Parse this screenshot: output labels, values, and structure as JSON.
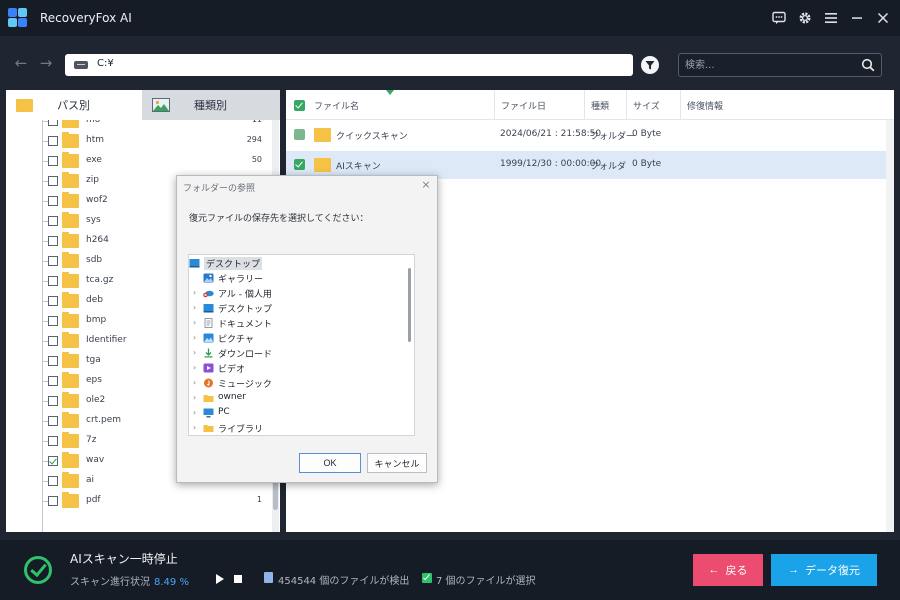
{
  "app": {
    "title": "RecoveryFox AI"
  },
  "colors": {
    "accent_green": "#2ec26b",
    "accent_blue": "#1aa3e8",
    "back_red": "#ec4c6f",
    "folder": "#f5c245"
  },
  "titlebar_icons": [
    "feedback-icon",
    "settings-gear-icon",
    "menu-icon",
    "minimize-icon",
    "close-icon"
  ],
  "address": {
    "path": "C:¥",
    "search_placeholder": "検索..."
  },
  "left_tabs": {
    "path_tab": "パス別",
    "type_tab": "種類別"
  },
  "tree_rows": [
    {
      "name": "mo~",
      "count": "11",
      "checked": false
    },
    {
      "name": "htm",
      "count": "294",
      "checked": false
    },
    {
      "name": "exe",
      "count": "50",
      "checked": false
    },
    {
      "name": "zip",
      "count": "",
      "checked": false
    },
    {
      "name": "wof2",
      "count": "",
      "checked": false
    },
    {
      "name": "sys",
      "count": "",
      "checked": false
    },
    {
      "name": "h264",
      "count": "",
      "checked": false
    },
    {
      "name": "sdb",
      "count": "",
      "checked": false
    },
    {
      "name": "tca.gz",
      "count": "",
      "checked": false
    },
    {
      "name": "deb",
      "count": "",
      "checked": false
    },
    {
      "name": "bmp",
      "count": "",
      "checked": false
    },
    {
      "name": "Identifier",
      "count": "",
      "checked": false
    },
    {
      "name": "tga",
      "count": "",
      "checked": false
    },
    {
      "name": "eps",
      "count": "",
      "checked": false
    },
    {
      "name": "ole2",
      "count": "",
      "checked": false
    },
    {
      "name": "crt.pem",
      "count": "",
      "checked": false
    },
    {
      "name": "7z",
      "count": "",
      "checked": false
    },
    {
      "name": "wav",
      "count": "",
      "checked": true
    },
    {
      "name": "ai",
      "count": "3",
      "checked": false
    },
    {
      "name": "pdf",
      "count": "1",
      "checked": false
    }
  ],
  "table": {
    "headers": {
      "name": "ファイル名",
      "date": "ファイル日",
      "type": "種類",
      "size": "サイズ",
      "extra": "修復情報"
    },
    "rows": [
      {
        "name": "クイックスキャン",
        "date": "2024/06/21 : 21:58:50",
        "type": "フォルダー",
        "size": "0 Byte",
        "checked": false,
        "selected": false
      },
      {
        "name": "AIスキャン",
        "date": "1999/12/30 : 00:00:00",
        "type": "フォルダ",
        "size": "0 Byte",
        "checked": true,
        "selected": true
      }
    ]
  },
  "dialog": {
    "title": "フォルダーの参照",
    "message": "復元ファイルの保存先を選択してください：",
    "items": [
      {
        "label": "デスクトップ",
        "icon": "desktop-icon"
      },
      {
        "label": "ギャラリー",
        "icon": "gallery-icon"
      },
      {
        "label": "アル - 個人用",
        "icon": "onedrive-icon"
      },
      {
        "label": "デスクトップ",
        "icon": "desktop-icon"
      },
      {
        "label": "ドキュメント",
        "icon": "document-icon"
      },
      {
        "label": "ピクチャ",
        "icon": "pictures-icon"
      },
      {
        "label": "ダウンロード",
        "icon": "download-icon"
      },
      {
        "label": "ビデオ",
        "icon": "video-icon"
      },
      {
        "label": "ミュージック",
        "icon": "music-icon"
      },
      {
        "label": "owner",
        "icon": "folder-icon"
      },
      {
        "label": "PC",
        "icon": "pc-icon"
      },
      {
        "label": "ライブラリ",
        "icon": "folder-icon"
      }
    ],
    "ok": "OK",
    "cancel": "キャンセル"
  },
  "bottom": {
    "scan_title": "AIスキャン一時停止",
    "progress_label": "スキャン進行状況",
    "progress_pct": "8.49 %",
    "progress_value": 8.49,
    "found_text": "454544 個のファイルが検出",
    "selected_text": "7 個のファイルが選択",
    "back": "戻る",
    "recover": "データ復元"
  }
}
